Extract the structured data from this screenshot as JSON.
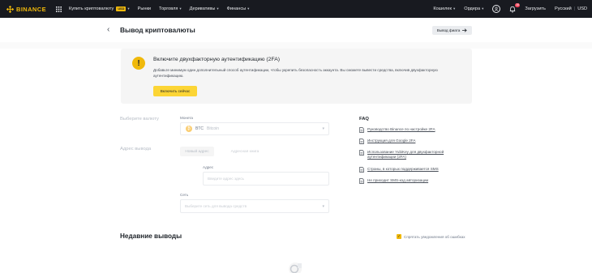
{
  "topnav": {
    "brand": "BINANCE",
    "items": [
      {
        "label": "Купить криптовалюту",
        "caret": "▾",
        "badge": "USD"
      },
      {
        "label": "Рынки",
        "caret": ""
      },
      {
        "label": "Торговля",
        "caret": "▾"
      },
      {
        "label": "Деривативы",
        "caret": "▾"
      },
      {
        "label": "Финансы",
        "caret": "▾"
      }
    ],
    "right": {
      "wallet": "Кошелек",
      "orders": "Ордера",
      "notif_count": "18",
      "download": "Загрузить",
      "language": "Русский",
      "separator": "|",
      "currency": "USD"
    },
    "accent": "#f0b90b",
    "background": "#181a20"
  },
  "header": {
    "back_icon": "chevron-left-icon",
    "title": "Вывод криптовалюты",
    "fiat_button": "Вывод фиата",
    "fiat_icon": "arrow-right-icon"
  },
  "warning": {
    "icon": "!",
    "title": "Включите двухфакторную аутентификацию (2FA)",
    "description": "Добавьте минимум один дополнительный способ аутентификации, чтобы укрепить безопасность аккаунта. Вы сможете вывести средства, включив двухфакторную аутентификацию.",
    "button": "Включить сейчас"
  },
  "form": {
    "select_coin_label": "Выберите валюту",
    "coin_label": "Монета",
    "coin_symbol": "BTC",
    "coin_name": "Bitcoin",
    "coin_glyph": "₿",
    "address_section_label": "Адрес вывода",
    "tabs": [
      "Новый адрес",
      "Адресная книга"
    ],
    "address_label": "Адрес",
    "address_placeholder": "Введите адрес здесь",
    "network_label": "Сеть",
    "network_placeholder": "Выберите сеть для вывода средств",
    "caret": "▾"
  },
  "faq": {
    "title": "FAQ",
    "items": [
      "Руководство Binance по настройке 2FA",
      "Инструкция для Google 2FA",
      "Использование YubiKey для двухфакторной аутентификации (2FA)",
      "Страны, в которых поддерживается SMS",
      "Не приходит SMS-код авторизации"
    ]
  },
  "recent": {
    "title": "Недавние выводы",
    "hide_label": "Спрятать уведомления об ошибках",
    "hide_checked": true
  }
}
